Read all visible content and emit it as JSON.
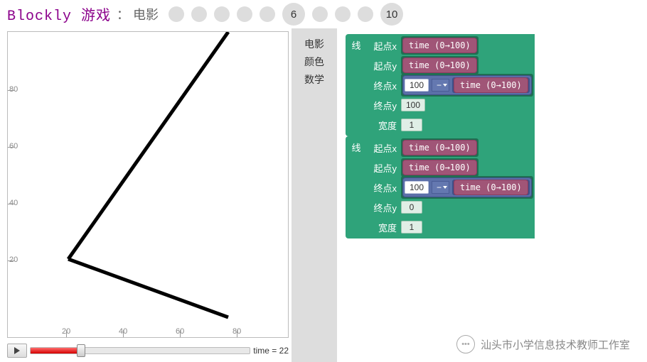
{
  "header": {
    "app": "Blockly 游戏",
    "sep": "：",
    "title": "电影"
  },
  "levels": {
    "current": "6",
    "last": "10"
  },
  "toolbox": {
    "i0": "电影",
    "i1": "颜色",
    "i2": "数学"
  },
  "canvas": {
    "ax": {
      "y80": "80",
      "y60": "60",
      "y40": "40",
      "y20": "20",
      "x20": "20",
      "x40": "40",
      "x60": "60",
      "x80": "80"
    }
  },
  "play": {
    "time_label": "time = 22",
    "time": 22
  },
  "labels": {
    "line": "线",
    "startx": "起点x",
    "starty": "起点y",
    "endx": "终点x",
    "endy": "终点y",
    "width": "宽度",
    "timefn": "time (0→100)",
    "minus": "−"
  },
  "nums": {
    "h100a": "100",
    "h100b": "100",
    "y100": "100",
    "w1a": "1",
    "y0": "0",
    "w1b": "1"
  },
  "wm": {
    "icon": "•••",
    "text": "汕头市小学信息技术教师工作室"
  }
}
